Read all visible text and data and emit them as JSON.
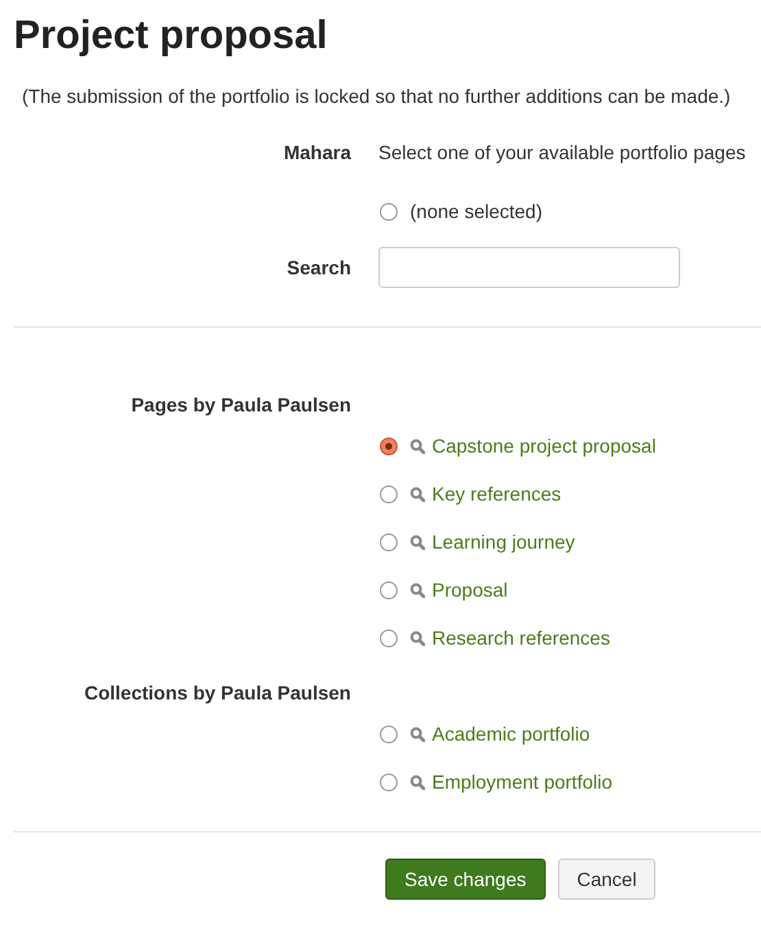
{
  "title": "Project proposal",
  "notice": "(The submission of the portfolio is locked so that no further additions can be made.)",
  "mahara": {
    "label": "Mahara",
    "description": "Select one of your available portfolio pages",
    "none_option": {
      "label": "(none selected)",
      "selected": false
    }
  },
  "search": {
    "label": "Search"
  },
  "groups": [
    {
      "label": "Pages by Paula Paulsen",
      "items": [
        {
          "label": "Capstone project proposal",
          "selected": true
        },
        {
          "label": "Key references",
          "selected": false
        },
        {
          "label": "Learning journey",
          "selected": false
        },
        {
          "label": "Proposal",
          "selected": false
        },
        {
          "label": "Research references",
          "selected": false
        }
      ]
    },
    {
      "label": "Collections by Paula Paulsen",
      "items": [
        {
          "label": "Academic portfolio",
          "selected": false
        },
        {
          "label": "Employment portfolio",
          "selected": false
        }
      ]
    }
  ],
  "buttons": [
    {
      "label": "Save changes",
      "kind": "primary"
    },
    {
      "label": "Cancel",
      "kind": "secondary"
    }
  ]
}
